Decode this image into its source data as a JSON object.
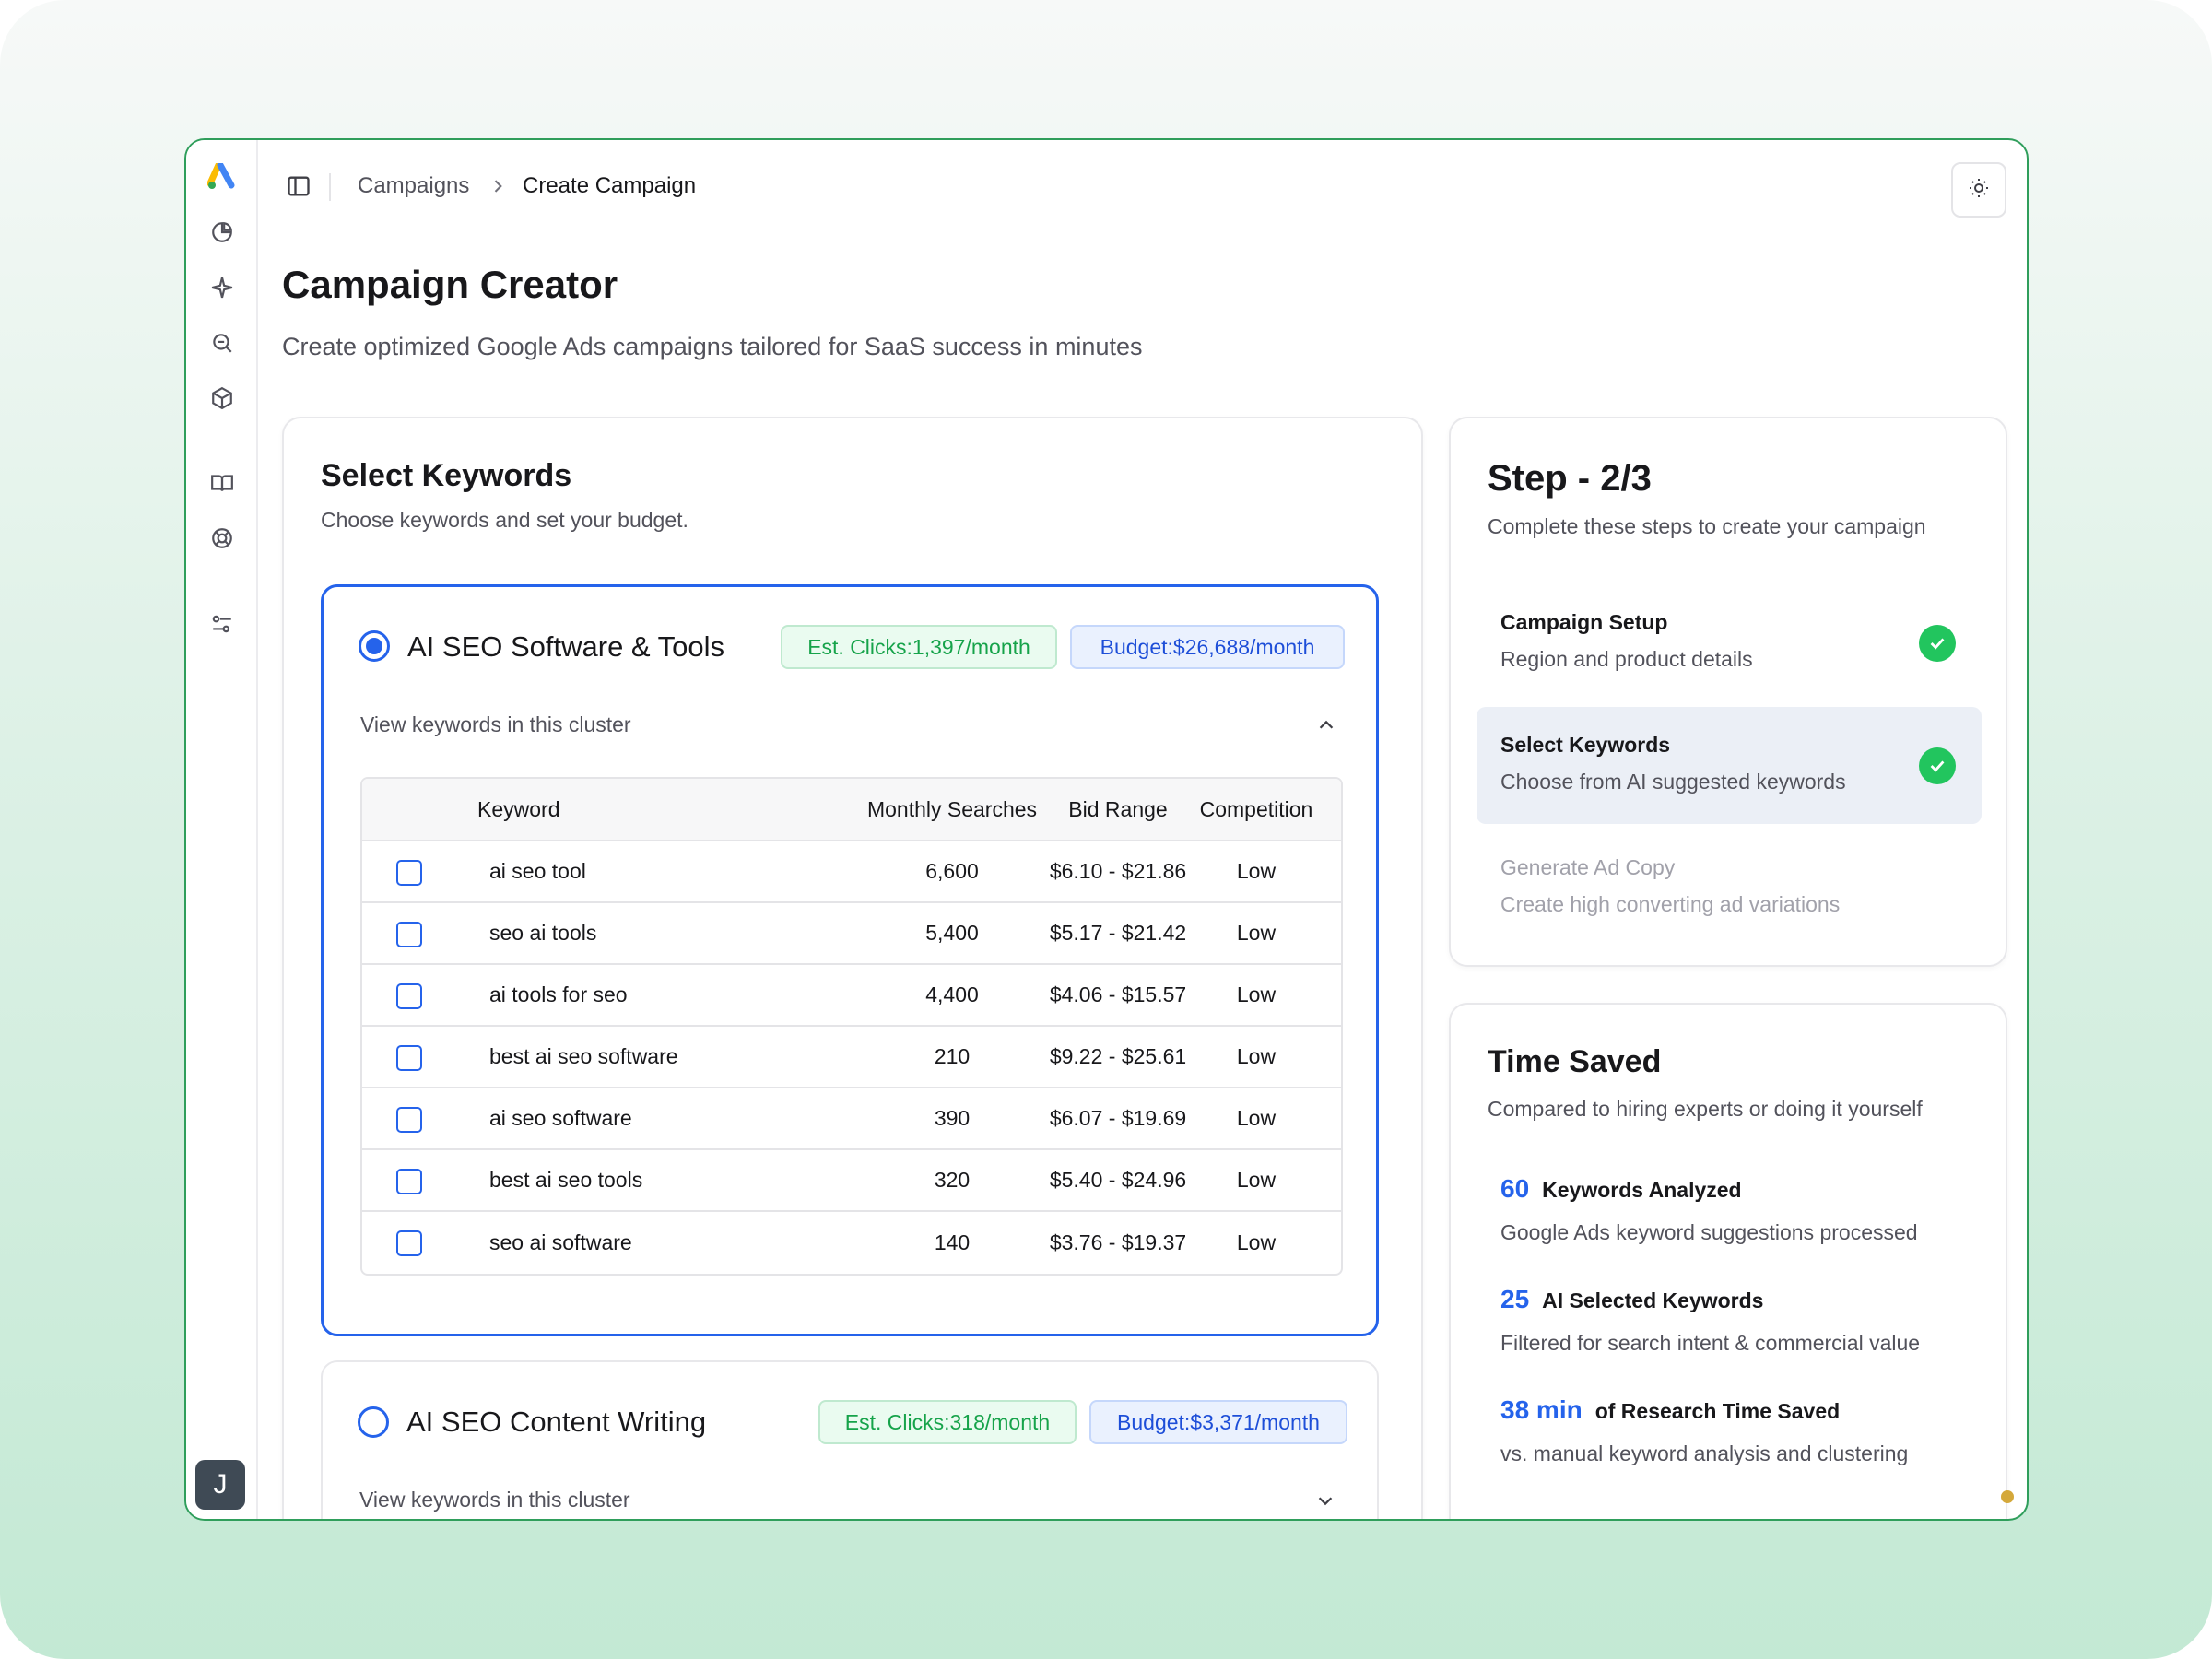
{
  "app": {
    "logo": "google-ads-logo",
    "avatar_initial": "J"
  },
  "rail": {
    "icons": [
      "pie-chart-icon",
      "sparkle-icon",
      "search-zoom-icon",
      "package-icon",
      "book-icon",
      "help-buoy-icon",
      "settings-sliders-icon"
    ]
  },
  "breadcrumb": {
    "parent": "Campaigns",
    "current": "Create Campaign"
  },
  "page": {
    "title": "Campaign Creator",
    "subtitle": "Create optimized Google Ads campaigns tailored for SaaS success in minutes"
  },
  "keywords_card": {
    "title": "Select Keywords",
    "subtitle": "Choose keywords and set your budget.",
    "clusters": [
      {
        "name": "AI SEO Software & Tools",
        "selected": true,
        "clicks": "Est. Clicks:1,397/month",
        "budget": "Budget:$26,688/month",
        "view_label": "View keywords in this cluster",
        "expanded": true,
        "columns": [
          "Keyword",
          "Monthly Searches",
          "Bid Range",
          "Competition"
        ],
        "rows": [
          {
            "keyword": "ai seo tool",
            "searches": "6,600",
            "bid": "$6.10 - $21.86",
            "competition": "Low"
          },
          {
            "keyword": "seo ai tools",
            "searches": "5,400",
            "bid": "$5.17 - $21.42",
            "competition": "Low"
          },
          {
            "keyword": "ai tools for seo",
            "searches": "4,400",
            "bid": "$4.06 - $15.57",
            "competition": "Low"
          },
          {
            "keyword": "best ai seo software",
            "searches": "210",
            "bid": "$9.22 - $25.61",
            "competition": "Low"
          },
          {
            "keyword": "ai seo software",
            "searches": "390",
            "bid": "$6.07 - $19.69",
            "competition": "Low"
          },
          {
            "keyword": "best ai seo tools",
            "searches": "320",
            "bid": "$5.40 - $24.96",
            "competition": "Low"
          },
          {
            "keyword": "seo ai software",
            "searches": "140",
            "bid": "$3.76 - $19.37",
            "competition": "Low"
          }
        ]
      },
      {
        "name": "AI SEO Content Writing",
        "selected": false,
        "clicks": "Est. Clicks:318/month",
        "budget": "Budget:$3,371/month",
        "view_label": "View keywords in this cluster",
        "expanded": false
      }
    ]
  },
  "steps_card": {
    "title": "Step - 2/3",
    "subtitle": "Complete these steps to create your campaign",
    "steps": [
      {
        "title": "Campaign Setup",
        "desc": "Region and product details",
        "done": true
      },
      {
        "title": "Select Keywords",
        "desc": "Choose from AI suggested keywords",
        "done": true
      },
      {
        "title": "Generate Ad Copy",
        "desc": "Create high converting ad variations",
        "done": false
      }
    ]
  },
  "time_card": {
    "title": "Time Saved",
    "subtitle": "Compared to hiring experts or doing it yourself",
    "stats": [
      {
        "value": "60",
        "label": "Keywords Analyzed",
        "desc": "Google Ads keyword suggestions processed"
      },
      {
        "value": "25",
        "label": "AI Selected Keywords",
        "desc": "Filtered for search intent & commercial value"
      },
      {
        "value": "38 min",
        "label": "of Research Time Saved",
        "desc": "vs. manual keyword analysis and clustering"
      }
    ]
  },
  "colors": {
    "accent": "#2563eb",
    "success": "#22c55e",
    "frame": "#2f9e5b"
  }
}
